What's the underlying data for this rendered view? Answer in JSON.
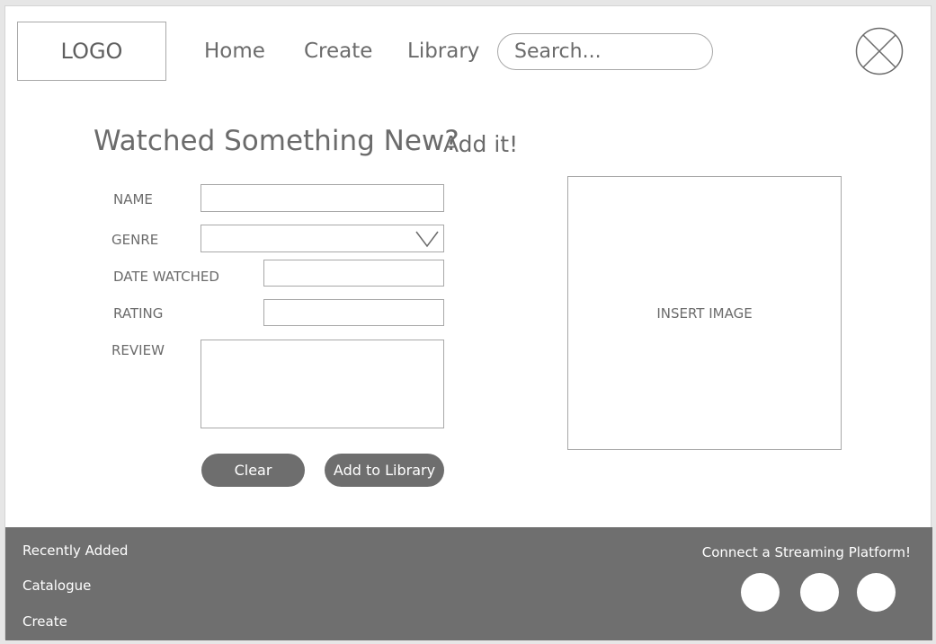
{
  "header": {
    "logo": "LOGO",
    "nav": {
      "home": "Home",
      "create": "Create",
      "library": "Library"
    },
    "search_placeholder": "Search...",
    "avatar_icon": "circle-x-icon"
  },
  "form": {
    "title": "Watched Something New?",
    "subtitle": "Add it!",
    "labels": {
      "name": "NAME",
      "genre": "GENRE",
      "date_watched": "DATE WATCHED",
      "rating": "RATING",
      "review": "REVIEW"
    },
    "values": {
      "name": "",
      "genre": "",
      "date_watched": "",
      "rating": "",
      "review": ""
    },
    "genre_dropdown_icon": "chevron-down-icon",
    "buttons": {
      "clear": "Clear",
      "add": "Add to Library"
    }
  },
  "image_placeholder": "INSERT IMAGE",
  "footer": {
    "links": [
      "Recently Added",
      "Catalogue",
      "Create"
    ],
    "connect_label": "Connect a Streaming Platform!",
    "platform_icons": [
      "platform-icon-1",
      "platform-icon-2",
      "platform-icon-3"
    ]
  },
  "colors": {
    "text": "#6b6b6b",
    "border": "#a8a8a8",
    "button_bg": "#6e6e6e",
    "footer_bg": "#6f6f6f",
    "footer_text": "#ffffff"
  }
}
